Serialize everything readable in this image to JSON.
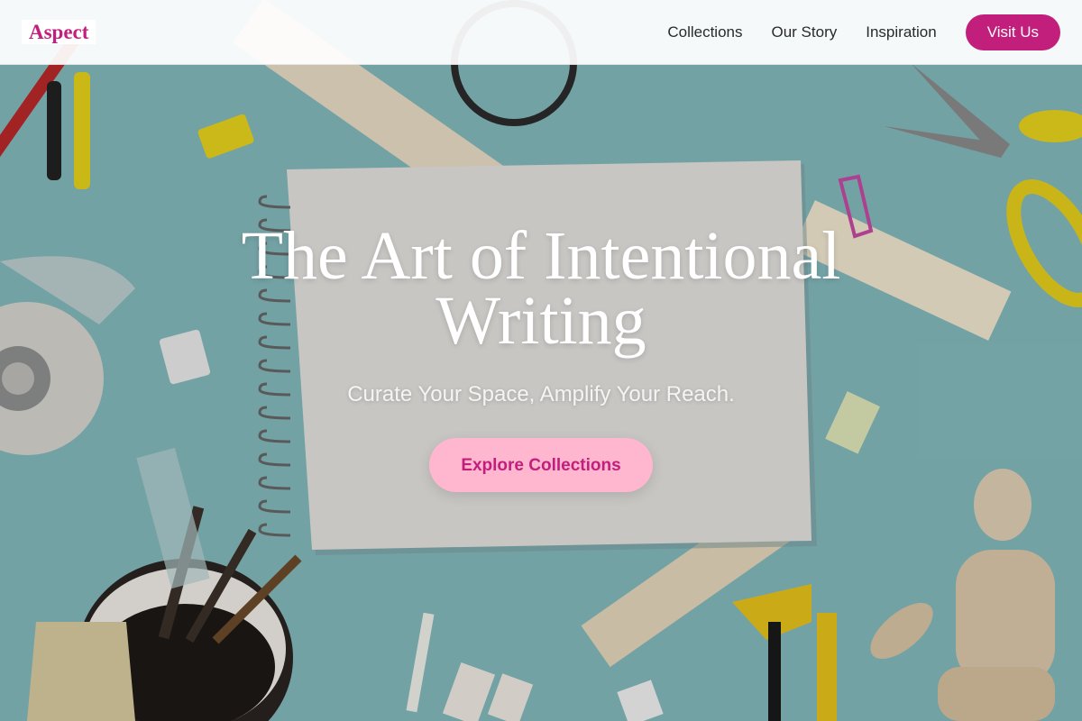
{
  "brand": {
    "name": "Aspect",
    "color": "#c21f7d"
  },
  "nav": {
    "links": [
      "Collections",
      "Our Story",
      "Inspiration"
    ],
    "cta_label": "Visit Us"
  },
  "hero": {
    "title": "The Art of Intentional Writing",
    "subtitle": "Curate Your Space, Amplify Your Reach.",
    "cta_label": "Explore Collections",
    "cta_bg": "#ffb6cf",
    "background": "flat-lay photo of stationery: spiral notebook, rulers, tape, scissors, paintbrushes, wooden mannequin on teal surface"
  }
}
